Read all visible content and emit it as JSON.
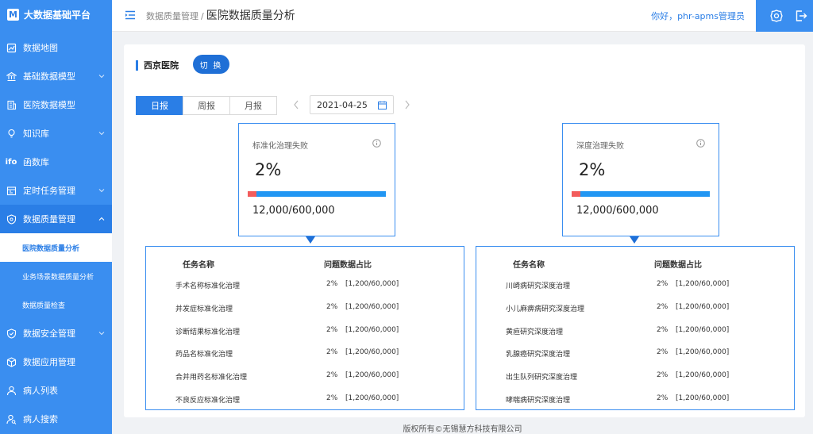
{
  "app": {
    "logo_letter": "M",
    "title": "大数据基础平台"
  },
  "sidebar": {
    "items": [
      {
        "label": "数据地图",
        "icon": "map-icon"
      },
      {
        "label": "基础数据模型",
        "icon": "bank-icon",
        "has_children": true
      },
      {
        "label": "医院数据模型",
        "icon": "hospital-doc-icon"
      },
      {
        "label": "知识库",
        "icon": "lightbulb-icon",
        "has_children": true
      },
      {
        "label": "函数库",
        "icon": "function-icon",
        "icon_text": "ifo"
      },
      {
        "label": "定时任务管理",
        "icon": "schedule-icon",
        "has_children": true
      },
      {
        "label": "数据质量管理",
        "icon": "shield-gear-icon",
        "has_children": true,
        "expanded": true
      },
      {
        "label": "数据安全管理",
        "icon": "shield-check-icon",
        "has_children": true
      },
      {
        "label": "数据应用管理",
        "icon": "cube-icon"
      },
      {
        "label": "病人列表",
        "icon": "user-icon"
      },
      {
        "label": "病人搜索",
        "icon": "user-search-icon"
      }
    ],
    "sub_items": [
      {
        "label": "医院数据质量分析",
        "active": true
      },
      {
        "label": "业务场景数据质量分析",
        "active": false
      },
      {
        "label": "数据质量检查",
        "active": false
      }
    ]
  },
  "header": {
    "breadcrumb_parent": "数据质量管理",
    "breadcrumb_sep": "/",
    "breadcrumb_current": "医院数据质量分析",
    "greeting": "你好，phr-apms管理员"
  },
  "main": {
    "hospital_name": "西京医院",
    "switch_label": "切 换",
    "period_tabs": [
      {
        "label": "日报",
        "active": true
      },
      {
        "label": "周报",
        "active": false
      },
      {
        "label": "月报",
        "active": false
      }
    ],
    "date": "2021-04-25",
    "stats": [
      {
        "title": "标准化治理失败",
        "percent": "2%",
        "fail_fraction": 0.02,
        "ratio": "12,000/600,000"
      },
      {
        "title": "深度治理失败",
        "percent": "2%",
        "fail_fraction": 0.02,
        "ratio": "12,000/600,000"
      }
    ],
    "tables": [
      {
        "col_task": "任务名称",
        "col_ratio": "问题数据占比",
        "rows": [
          {
            "name": "手术名称标准化治理",
            "pct": "2%",
            "range": "[1,200/60,000]"
          },
          {
            "name": "并发症标准化治理",
            "pct": "2%",
            "range": "[1,200/60,000]"
          },
          {
            "name": "诊断结果标准化治理",
            "pct": "2%",
            "range": "[1,200/60,000]"
          },
          {
            "name": "药品名标准化治理",
            "pct": "2%",
            "range": "[1,200/60,000]"
          },
          {
            "name": "合并用药名标准化治理",
            "pct": "2%",
            "range": "[1,200/60,000]"
          },
          {
            "name": "不良反应标准化治理",
            "pct": "2%",
            "range": "[1,200/60,000]"
          }
        ]
      },
      {
        "col_task": "任务名称",
        "col_ratio": "问题数据占比",
        "rows": [
          {
            "name": "川崎病研究深度治理",
            "pct": "2%",
            "range": "[1,200/60,000]"
          },
          {
            "name": "小儿麻痹病研究深度治理",
            "pct": "2%",
            "range": "[1,200/60,000]"
          },
          {
            "name": "黄疸研究深度治理",
            "pct": "2%",
            "range": "[1,200/60,000]"
          },
          {
            "name": "乳腺癌研究深度治理",
            "pct": "2%",
            "range": "[1,200/60,000]"
          },
          {
            "name": "出生队列研究深度治理",
            "pct": "2%",
            "range": "[1,200/60,000]"
          },
          {
            "name": "哮喘病研究深度治理",
            "pct": "2%",
            "range": "[1,200/60,000]"
          }
        ]
      }
    ]
  },
  "footer": "版权所有©无锡慧方科技有限公司",
  "colors": {
    "primary": "#3a8ef0",
    "accent": "#2a7ee6",
    "fail": "#f25c5c",
    "bar": "#2196f3"
  }
}
